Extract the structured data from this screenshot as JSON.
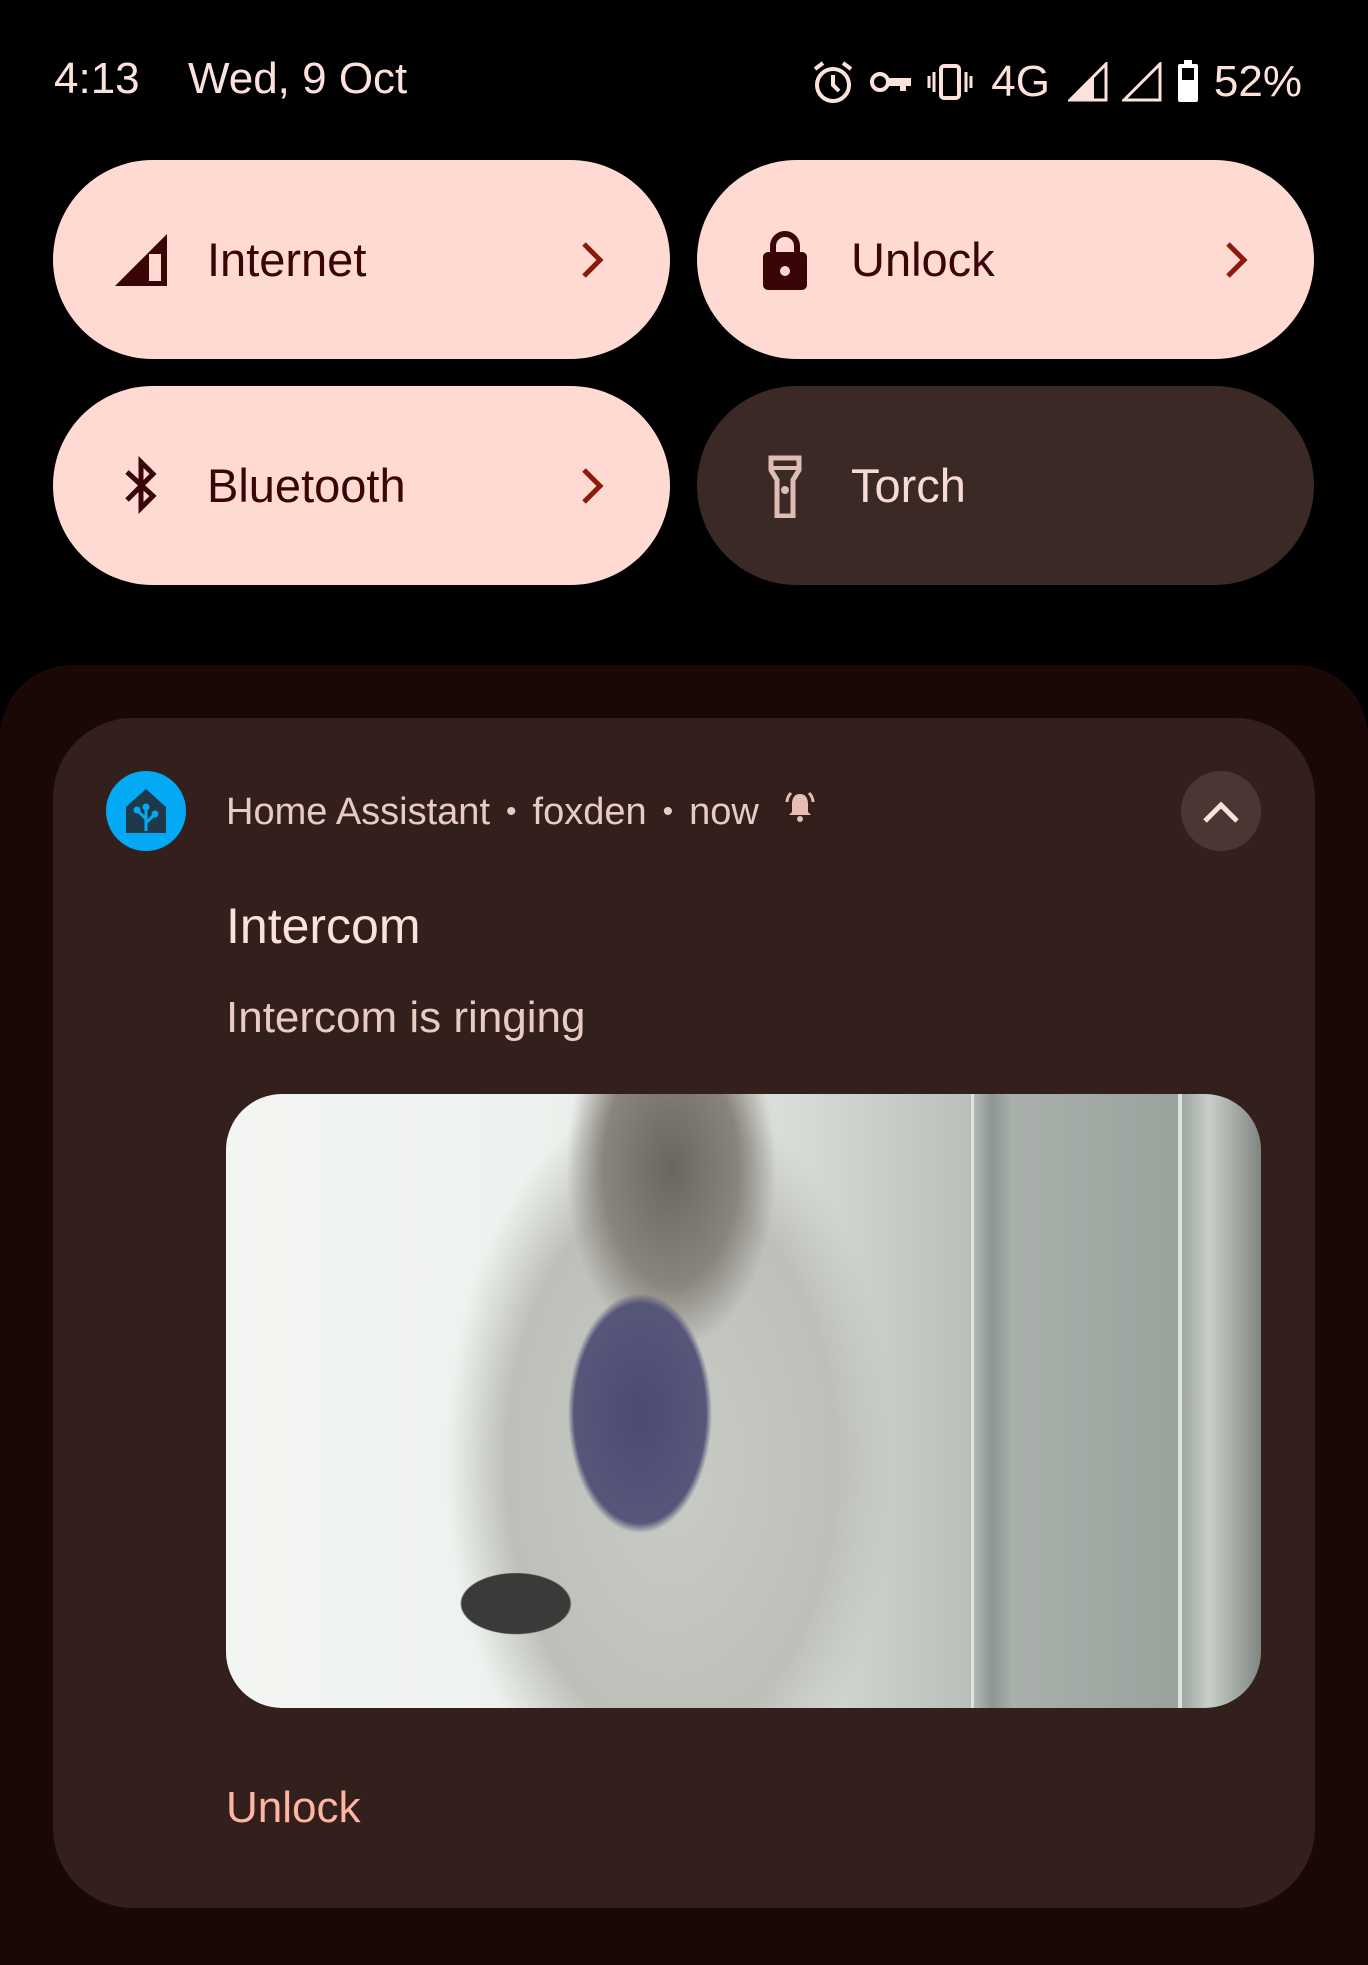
{
  "status_bar": {
    "time": "4:13",
    "date": "Wed, 9 Oct",
    "icons": [
      "alarm-icon",
      "vpn-key-icon",
      "vibrate-icon",
      "signal-icon",
      "signal-icon",
      "battery-icon"
    ],
    "network_type": "4G",
    "battery_percent": "52%"
  },
  "quick_settings": {
    "tiles": [
      {
        "label": "Internet",
        "icon": "cell-signal-icon",
        "state": "on",
        "has_chevron": true
      },
      {
        "label": "Unlock",
        "icon": "lock-icon",
        "state": "on",
        "has_chevron": true
      },
      {
        "label": "Bluetooth",
        "icon": "bluetooth-icon",
        "state": "on",
        "has_chevron": true
      },
      {
        "label": "Torch",
        "icon": "flashlight-icon",
        "state": "off",
        "has_chevron": false
      }
    ]
  },
  "notification": {
    "app_name": "Home Assistant",
    "separator": "•",
    "subtext": "foxden",
    "time": "now",
    "title": "Intercom",
    "body": "Intercom is ringing",
    "image_description": "Intercom camera snapshot of a person holding a phone",
    "actions": [
      "Unlock"
    ]
  },
  "colors": {
    "tile_on_bg": "#ffdad3",
    "tile_off_bg": "#3a2924",
    "card_bg": "#33201c",
    "app_icon_bg": "#03a9f4",
    "action_text": "#ffb4a4"
  }
}
